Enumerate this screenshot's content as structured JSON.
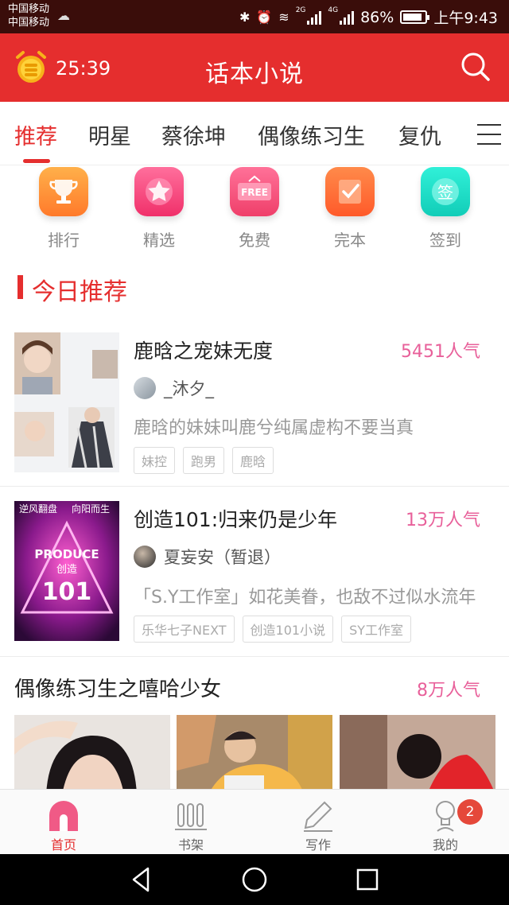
{
  "status_bar": {
    "carrier_1": "中国移动",
    "carrier_2": "中国移动",
    "network_label": "4G",
    "network_label_2": "2G",
    "battery": "86%",
    "battery_level": 0.86,
    "time": "上午9:43"
  },
  "header": {
    "timer": "25:39",
    "title": "话本小说",
    "timer_icon": "alarm-coin-icon",
    "search_icon": "search-icon"
  },
  "tabs": [
    {
      "label": "推荐",
      "active": true
    },
    {
      "label": "明星"
    },
    {
      "label": "蔡徐坤"
    },
    {
      "label": "偶像练习生"
    },
    {
      "label": "复仇"
    }
  ],
  "quick_entries": [
    {
      "label": "排行",
      "icon": "trophy-icon",
      "color": "#ff8a3d"
    },
    {
      "label": "精选",
      "icon": "star-icon",
      "color": "#f5457a"
    },
    {
      "label": "免费",
      "icon": "free-tag-icon",
      "color": "#f2507a"
    },
    {
      "label": "完本",
      "icon": "check-note-icon",
      "color": "#ff6a3d"
    },
    {
      "label": "签到",
      "icon": "sign-in-icon",
      "color": "#18ddc8"
    }
  ],
  "section": {
    "title": "今日推荐"
  },
  "books": [
    {
      "title": "鹿晗之宠妹无度",
      "popularity": "5451人气",
      "author": "_沐夕_",
      "description": "鹿晗的妹妹叫鹿兮纯属虚构不要当真",
      "tags": [
        "妹控",
        "跑男",
        "鹿晗"
      ]
    },
    {
      "title": "创造101:归来仍是少年",
      "popularity": "13万人气",
      "author": "夏妄安（暂退）",
      "description": "「S.Y工作室」如花美眷，也敌不过似水流年",
      "tags": [
        "乐华七子NEXT",
        "创造101小说",
        "SY工作室"
      ],
      "cover_text": {
        "top_left": "逆风翻盘",
        "top_right": "向阳而生",
        "brand": "PRODUCE",
        "sub": "创造",
        "number": "101"
      }
    },
    {
      "title": "偶像练习生之嘻哈少女",
      "popularity": "8万人气"
    }
  ],
  "bottom_nav": [
    {
      "label": "首页",
      "icon": "home-icon",
      "active": true
    },
    {
      "label": "书架",
      "icon": "bookshelf-icon"
    },
    {
      "label": "写作",
      "icon": "pen-icon"
    },
    {
      "label": "我的",
      "icon": "profile-icon",
      "badge": "2"
    }
  ],
  "colors": {
    "brand": "#e52e2e",
    "popularity": "#e8609a"
  }
}
